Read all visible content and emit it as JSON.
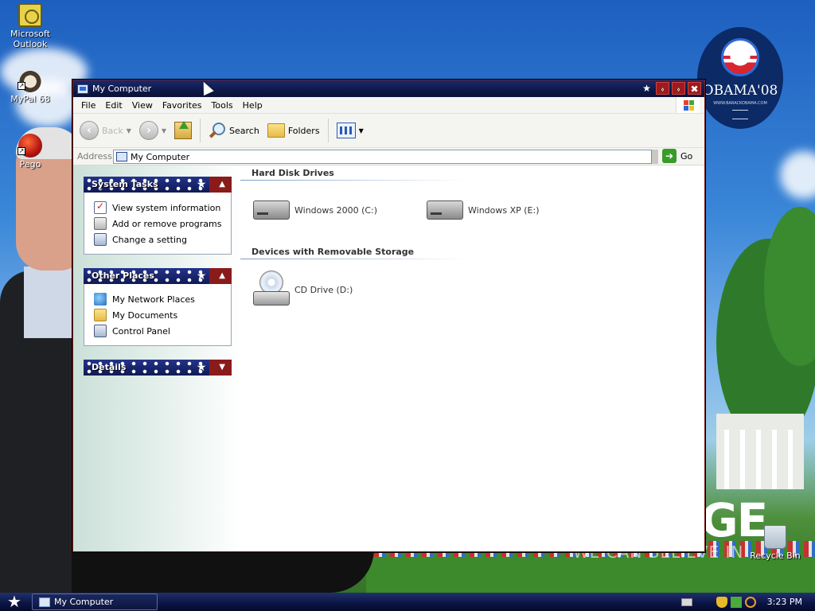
{
  "desktop": {
    "icons": [
      {
        "label": "Microsoft\nOutlook",
        "icon": "outlook-icon"
      },
      {
        "label": "MyPal 68",
        "icon": "mypal-icon"
      },
      {
        "label": "Pego",
        "icon": "pego-icon"
      },
      {
        "label": "Recycle Bin",
        "icon": "recycle-bin-icon"
      }
    ],
    "logo_text": "OBAMA'08",
    "logo_subtext": "WWW.BARACKOBAMA.COM",
    "slogan": "GE",
    "slogan_sub": "WE CAN BELIEVE IN"
  },
  "window": {
    "title": "My Computer",
    "menu": [
      "File",
      "Edit",
      "View",
      "Favorites",
      "Tools",
      "Help"
    ],
    "toolbar": {
      "back": "Back",
      "search": "Search",
      "folders": "Folders"
    },
    "address": {
      "label": "Address",
      "value": "My Computer",
      "go": "Go"
    },
    "panels": [
      {
        "title": "System Tasks",
        "items": [
          "View system information",
          "Add or remove programs",
          "Change a setting"
        ]
      },
      {
        "title": "Other Places",
        "items": [
          "My Network Places",
          "My Documents",
          "Control Panel"
        ]
      },
      {
        "title": "Details",
        "items": []
      }
    ],
    "sections": [
      {
        "title": "Hard Disk Drives",
        "items": [
          "Windows 2000 (C:)",
          "Windows XP (E:)"
        ]
      },
      {
        "title": "Devices with Removable Storage",
        "items": [
          "CD Drive (D:)"
        ]
      }
    ]
  },
  "taskbar": {
    "task_label": "My Computer",
    "clock": "3:23 PM"
  }
}
